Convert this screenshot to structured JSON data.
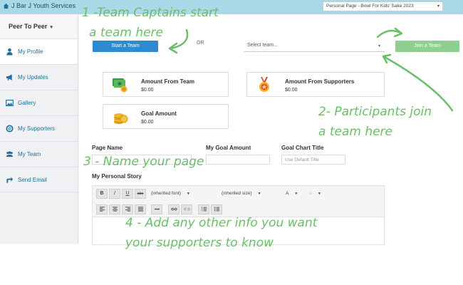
{
  "topbar": {
    "brand": "J Bar J Youth Services",
    "page_select": "Personal Page - Bowl For Kids' Sake 2023"
  },
  "sidebar": {
    "header": "Peer To Peer",
    "items": [
      {
        "label": "My Profile",
        "icon": "person-icon"
      },
      {
        "label": "My Updates",
        "icon": "megaphone-icon"
      },
      {
        "label": "Gallery",
        "icon": "image-icon"
      },
      {
        "label": "My Supporters",
        "icon": "lifebuoy-icon"
      },
      {
        "label": "My Team",
        "icon": "group-icon"
      },
      {
        "label": "Send Email",
        "icon": "share-arrow-icon"
      }
    ]
  },
  "team": {
    "start_label": "Start a Team",
    "or_text": "OR",
    "select_placeholder": "Select team...",
    "join_label": "Join a Team"
  },
  "stats": {
    "from_team": {
      "label": "Amount From Team",
      "value": "$0.00"
    },
    "from_supporters": {
      "label": "Amount From Supporters",
      "value": "$0.00"
    },
    "goal": {
      "label": "Goal Amount",
      "value": "$0.00"
    }
  },
  "form": {
    "page_name_label": "Page Name",
    "goal_amount_label": "My Goal Amount",
    "chart_title_label": "Goal Chart Title",
    "chart_title_placeholder": "Use Default Title",
    "story_label": "My Personal Story"
  },
  "editor": {
    "bold": "B",
    "italic": "I",
    "underline": "U",
    "strike": "abc",
    "font": "(inherited font)",
    "size": "(inherited size)",
    "text_color": "A",
    "bg_color": "◌"
  },
  "annotations": {
    "a1_line1": "1 -Team Captains start",
    "a1_line2": "a team here",
    "a2_line1": "2- Participants join",
    "a2_line2": "a team here",
    "a3": "3 - Name your page",
    "a4_line1": "4 - Add any other info you want",
    "a4_line2": "your supporters to know"
  },
  "colors": {
    "topbar": "#a9d9e7",
    "primary": "#2e8bd0",
    "join": "#8fcf8f",
    "annotation": "#6abf6a",
    "link": "#1f6f9c"
  }
}
